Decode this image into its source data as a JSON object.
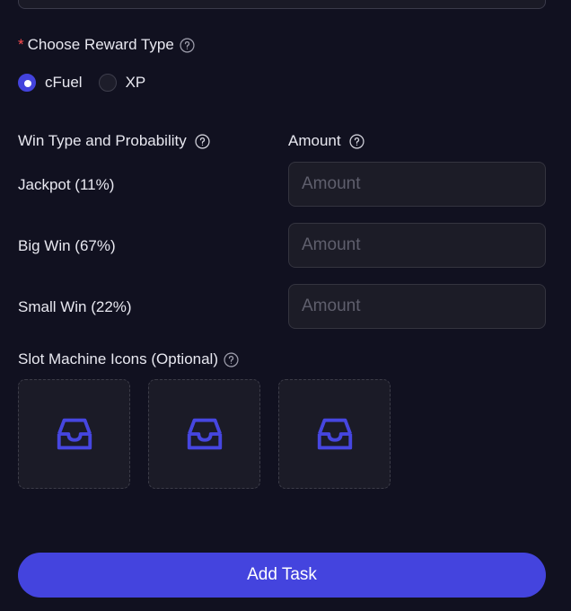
{
  "reward_type": {
    "label": "Choose Reward Type",
    "required_mark": "*",
    "options": [
      {
        "label": "cFuel",
        "checked": true
      },
      {
        "label": "XP",
        "checked": false
      }
    ]
  },
  "win_table": {
    "type_header": "Win Type and Probability",
    "amount_header": "Amount",
    "rows": [
      {
        "label": "Jackpot (11%)",
        "placeholder": "Amount"
      },
      {
        "label": "Big Win (67%)",
        "placeholder": "Amount"
      },
      {
        "label": "Small Win (22%)",
        "placeholder": "Amount"
      }
    ]
  },
  "slot_icons": {
    "label": "Slot Machine Icons (Optional)",
    "upload_slots": 3
  },
  "submit": {
    "label": "Add Task"
  },
  "colors": {
    "background": "#111120",
    "accent": "#4444de",
    "required": "#ff4d4f"
  },
  "icons": {
    "help": "question-circle-icon",
    "upload": "inbox-tray-icon"
  }
}
